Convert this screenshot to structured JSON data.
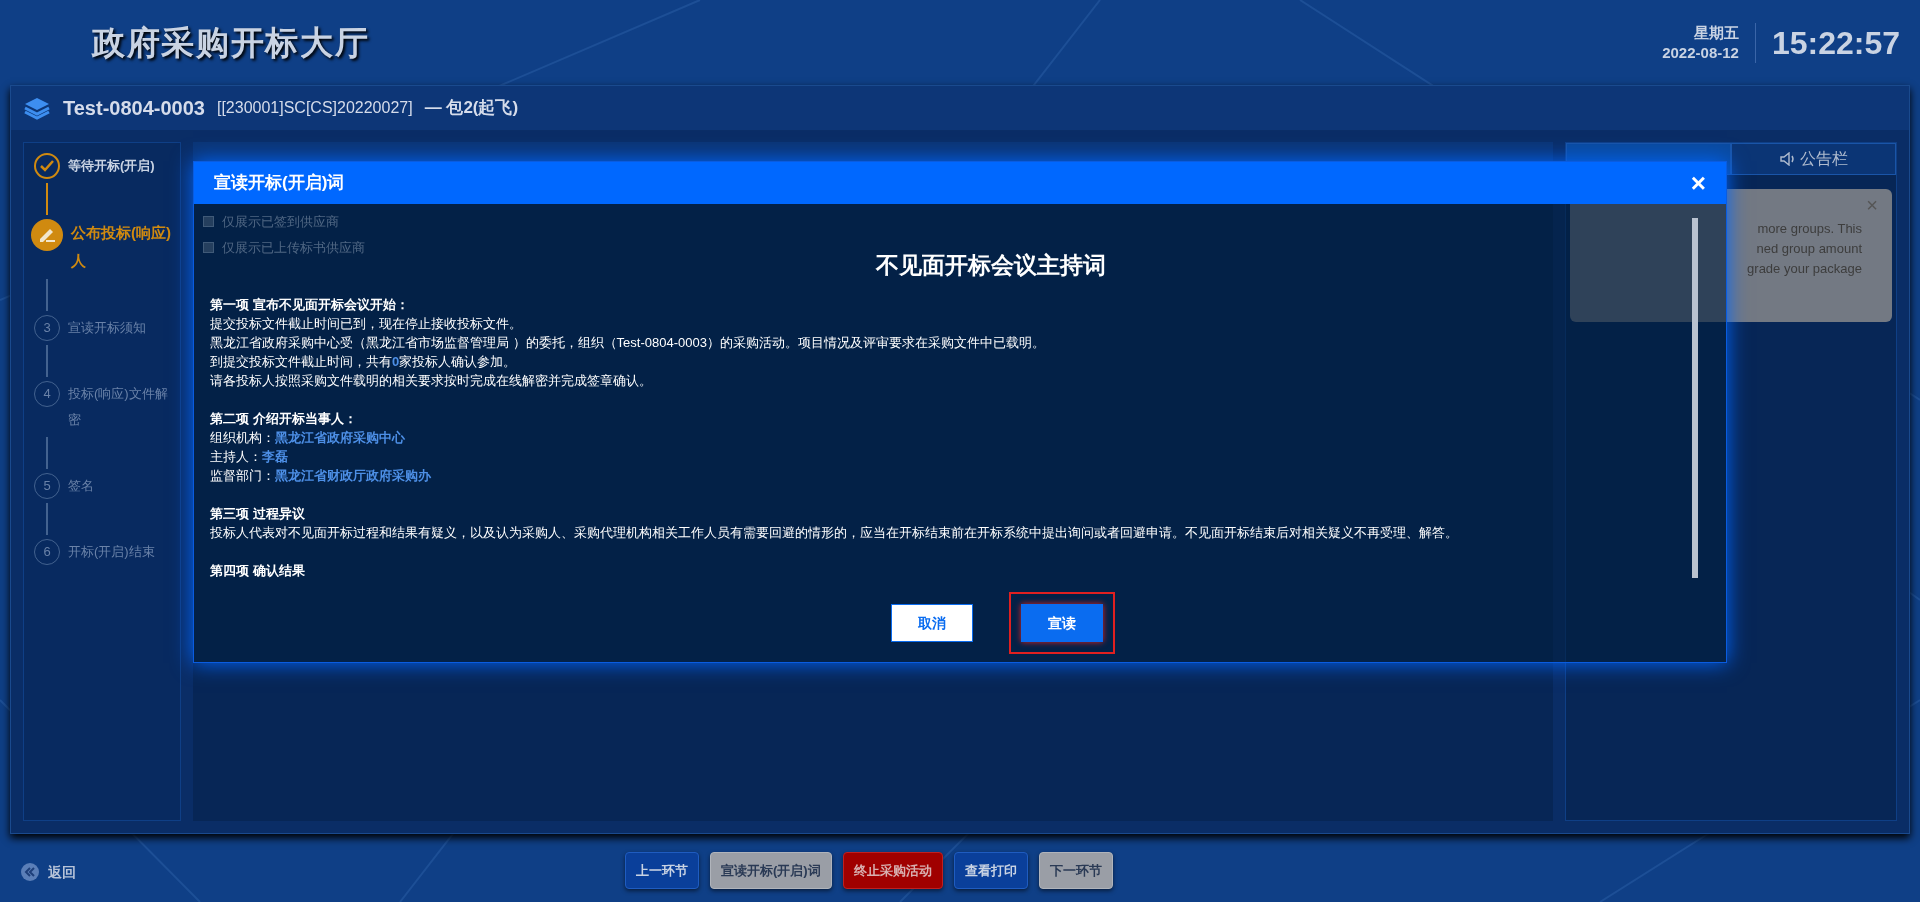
{
  "header": {
    "title": "政府采购开标大厅",
    "weekday": "星期五",
    "date": "2022-08-12",
    "time": "15:22:57"
  },
  "project": {
    "code": "Test-0804-0003",
    "number": "[[230001]SC[CS]20220027]",
    "package": "— 包2(起飞)"
  },
  "steps": [
    {
      "label": "等待开标(开启)",
      "done": true,
      "current": false
    },
    {
      "label": "公布投标(响应)人",
      "done": false,
      "current": true
    },
    {
      "number": "3",
      "label": "宣读开标须知",
      "done": false,
      "current": false
    },
    {
      "number": "4",
      "label": "投标(响应)文件解密",
      "done": false,
      "current": false
    },
    {
      "number": "5",
      "label": "签名",
      "done": false,
      "current": false
    },
    {
      "number": "6",
      "label": "开标(开启)结束",
      "done": false,
      "current": false
    }
  ],
  "filters": [
    {
      "label": "仅展示已签到供应商",
      "checked": false
    },
    {
      "label": "仅展示已上传标书供应商",
      "checked": false
    }
  ],
  "right_panel": {
    "tabs": [
      {
        "selected": true
      },
      {
        "label": "公告栏",
        "selected": false
      }
    ],
    "toast_close": "×",
    "toast_lines": [
      "more groups. This",
      "ned group amount",
      "grade your package"
    ]
  },
  "dialog": {
    "title": "宣读开标(开启)词",
    "close": "×",
    "heading": "不见面开标会议主持词",
    "sections": [
      {
        "heading": "第一项 宣布不见面开标会议开始：",
        "lines": [
          [
            {
              "text": "提交投标文件截止时间已到，现在停止接收投标文件。",
              "kind": "plain"
            }
          ],
          [
            {
              "text": "黑龙江省政府采购中心受（黑龙江省市场监督管理局 ）的委托，组织（Test-0804-0003）的采购活动。项目情况及评审要求在采购文件中已载明。",
              "kind": "plain"
            }
          ],
          [
            {
              "text": "到提交投标文件截止时间，共有",
              "kind": "plain"
            },
            {
              "text": "0",
              "kind": "value"
            },
            {
              "text": "家投标人确认参加。",
              "kind": "plain"
            }
          ],
          [
            {
              "text": "请各投标人按照采购文件载明的相关要求按时完成在线解密并完成签章确认。",
              "kind": "plain"
            }
          ]
        ]
      },
      {
        "heading": "第二项 介绍开标当事人：",
        "lines": [
          [
            {
              "text": "组织机构：",
              "kind": "plain"
            },
            {
              "text": "黑龙江省政府采购中心",
              "kind": "value"
            }
          ],
          [
            {
              "text": "主持人：",
              "kind": "plain"
            },
            {
              "text": "李磊",
              "kind": "value"
            }
          ],
          [
            {
              "text": "监督部门：",
              "kind": "plain"
            },
            {
              "text": "黑龙江省财政厅政府采购办",
              "kind": "value"
            }
          ]
        ]
      },
      {
        "heading": "第三项 过程异议",
        "lines": [
          [
            {
              "text": "投标人代表对不见面开标过程和结果有疑义，以及认为采购人、采购代理机构相关工作人员有需要回避的情形的，应当在开标结束前在开标系统中提出询问或者回避申请。不见面开标结束后对相关疑义不再受理、解答。",
              "kind": "plain"
            }
          ]
        ]
      },
      {
        "heading": "第四项 确认结果"
      }
    ],
    "buttons": [
      {
        "label": "取消",
        "kind": "secondary",
        "highlighted": false
      },
      {
        "label": "宣读",
        "kind": "primary",
        "highlighted": true
      }
    ]
  },
  "back": "返回",
  "footer_buttons": [
    {
      "label": "上一环节",
      "kind": "blue"
    },
    {
      "label": "宣读开标(开启)词",
      "kind": "gray"
    },
    {
      "label": "终止采购活动",
      "kind": "red"
    },
    {
      "label": "查看打印",
      "kind": "blue"
    },
    {
      "label": "下一环节",
      "kind": "gray"
    }
  ]
}
